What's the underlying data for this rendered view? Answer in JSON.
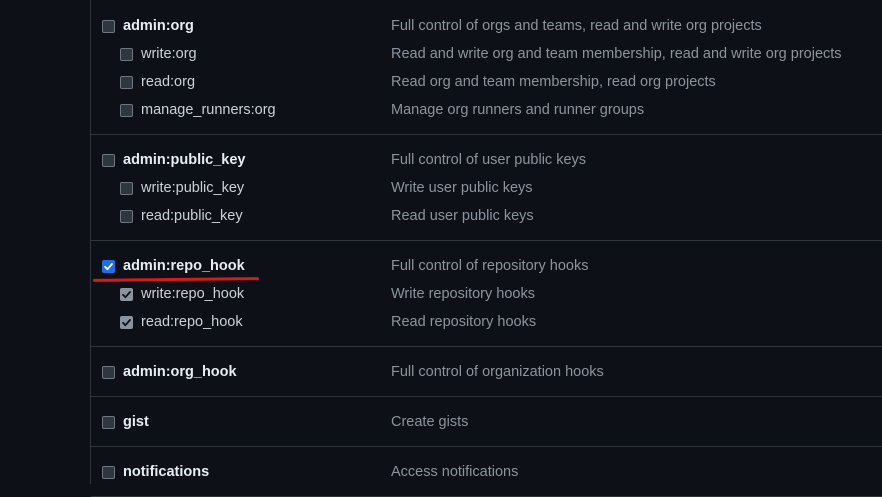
{
  "groups": [
    {
      "parent": {
        "scope": "admin:org",
        "description": "Full control of orgs and teams, read and write org projects",
        "checked": false
      },
      "children": [
        {
          "scope": "write:org",
          "description": "Read and write org and team membership, read and write org projects",
          "checked": false
        },
        {
          "scope": "read:org",
          "description": "Read org and team membership, read org projects",
          "checked": false
        },
        {
          "scope": "manage_runners:org",
          "description": "Manage org runners and runner groups",
          "checked": false
        }
      ]
    },
    {
      "parent": {
        "scope": "admin:public_key",
        "description": "Full control of user public keys",
        "checked": false
      },
      "children": [
        {
          "scope": "write:public_key",
          "description": "Write user public keys",
          "checked": false
        },
        {
          "scope": "read:public_key",
          "description": "Read user public keys",
          "checked": false
        }
      ]
    },
    {
      "parent": {
        "scope": "admin:repo_hook",
        "description": "Full control of repository hooks",
        "checked": true
      },
      "children": [
        {
          "scope": "write:repo_hook",
          "description": "Write repository hooks",
          "checked": true
        },
        {
          "scope": "read:repo_hook",
          "description": "Read repository hooks",
          "checked": true
        }
      ]
    },
    {
      "parent": {
        "scope": "admin:org_hook",
        "description": "Full control of organization hooks",
        "checked": false
      },
      "children": []
    },
    {
      "parent": {
        "scope": "gist",
        "description": "Create gists",
        "checked": false
      },
      "children": []
    },
    {
      "parent": {
        "scope": "notifications",
        "description": "Access notifications",
        "checked": false
      },
      "children": []
    }
  ],
  "colors": {
    "background": "#0d1117",
    "border": "#30363d",
    "checked_accent": "#1f6feb",
    "annotation_underline": "#d71b1b"
  }
}
